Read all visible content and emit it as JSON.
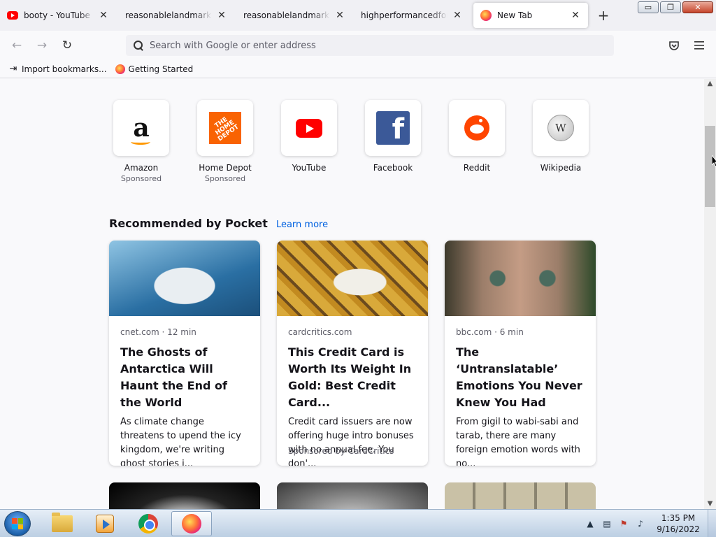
{
  "tabs": [
    {
      "title": "booty - YouTube",
      "favicon": "youtube-icon"
    },
    {
      "title": "reasonablelandmark.com",
      "favicon": "none"
    },
    {
      "title": "reasonablelandmark.com",
      "favicon": "none"
    },
    {
      "title": "highperformancedformat.com",
      "favicon": "none"
    },
    {
      "title": "New Tab",
      "favicon": "firefox-icon",
      "active": true
    }
  ],
  "window_controls": {
    "minimize": "▭",
    "restore": "❐",
    "close": "✕"
  },
  "navbar": {
    "back": "←",
    "forward": "→",
    "reload": "↻",
    "search_placeholder": "Search with Google or enter address"
  },
  "bookmarks": [
    {
      "label": "Import bookmarks...",
      "icon": "import-icon"
    },
    {
      "label": "Getting Started",
      "icon": "firefox-icon"
    }
  ],
  "top_sites": [
    {
      "name": "Amazon",
      "sub": "Sponsored"
    },
    {
      "name": "Home Depot",
      "sub": "Sponsored",
      "logo_text": "THE HOME DEPOT"
    },
    {
      "name": "YouTube",
      "sub": ""
    },
    {
      "name": "Facebook",
      "sub": "",
      "logo_text": "f"
    },
    {
      "name": "Reddit",
      "sub": ""
    },
    {
      "name": "Wikipedia",
      "sub": "",
      "logo_text": "W"
    }
  ],
  "pocket": {
    "heading": "Recommended by Pocket",
    "learn_more": "Learn more",
    "cards": [
      {
        "meta": "cnet.com · 12 min",
        "title": "The Ghosts of Antarctica Will Haunt the End of the World",
        "desc": "As climate change threatens to upend the icy kingdom, we're writing ghost stories i...",
        "sponsor": ""
      },
      {
        "meta": "cardcritics.com",
        "title": "This Credit Card is Worth Its Weight In Gold: Best Credit Card...",
        "desc": "Credit card issuers are now offering huge intro bonuses with no annual fee. You don'...",
        "sponsor": "Sponsored by CardCritics"
      },
      {
        "meta": "bbc.com · 6 min",
        "title": "The ‘Untranslatable’ Emotions You Never Knew You Had",
        "desc": "From gigil to wabi-sabi and tarab, there are many foreign emotion words with no...",
        "sponsor": ""
      }
    ]
  },
  "taskbar": {
    "apps": [
      "explorer-icon",
      "media-player-icon",
      "chrome-icon",
      "firefox-icon"
    ],
    "time": "1:35 PM",
    "date": "9/16/2022"
  }
}
